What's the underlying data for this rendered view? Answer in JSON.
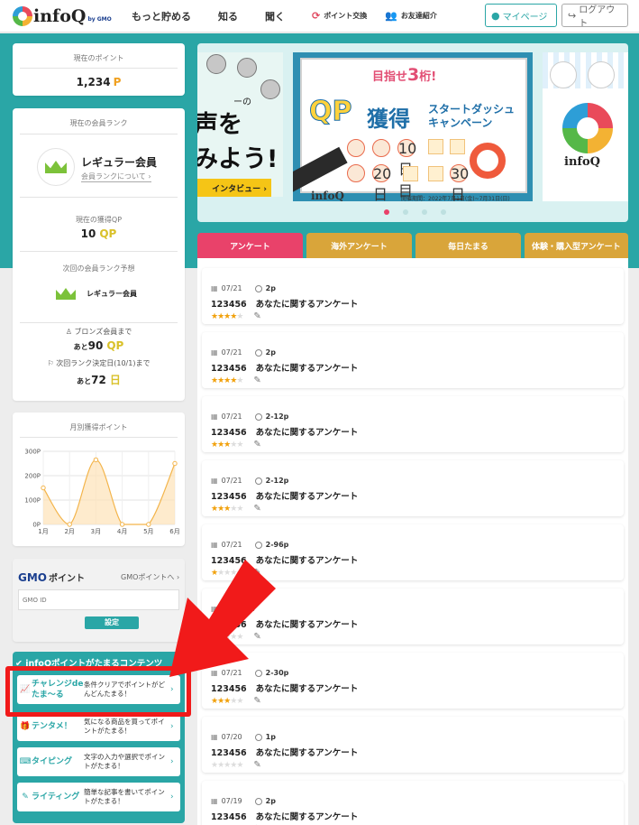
{
  "header": {
    "logo_text": "infoQ",
    "logo_sub": "by GMO",
    "nav": [
      "もっと貯める",
      "知る",
      "聞く"
    ],
    "nav_small": [
      "ポイント交換",
      "お友達紹介"
    ],
    "mypage_label": "マイページ",
    "logout_label": "ログアウト"
  },
  "points": {
    "title": "現在のポイント",
    "value": "1,234",
    "unit": "P"
  },
  "rank": {
    "title": "現在の会員ランク",
    "name": "レギュラー会員",
    "link": "会員ランクについて",
    "current_qp_title": "現在の獲得QP",
    "current_qp": "10",
    "qp_unit": "QP",
    "next_title": "次回の会員ランク予想",
    "next_rank": "レギュラー会員",
    "bronze_line": "ブロンズ会員まで",
    "bronze_prefix": "あと",
    "bronze_value": "90",
    "bronze_unit": "QP",
    "deadline_line": "次回ランク決定日(10/1)まで",
    "deadline_prefix": "あと",
    "deadline_value": "72",
    "deadline_unit": "日"
  },
  "chart_title": "月別獲得ポイント",
  "chart_data": {
    "type": "area",
    "title": "月別獲得ポイント",
    "categories": [
      "1月",
      "2月",
      "3月",
      "4月",
      "5月",
      "6月"
    ],
    "values": [
      150,
      0,
      265,
      0,
      0,
      250
    ],
    "y_ticks": [
      "0P",
      "100P",
      "200P",
      "300P"
    ],
    "ylim": [
      0,
      300
    ],
    "grid": true,
    "colors": {
      "line": "#f3b44a",
      "fill": "#fde3b8"
    }
  },
  "gmo": {
    "logo": "GMO",
    "logo_sub": "ポイント",
    "link": "GMOポイントへ",
    "input_placeholder": "GMO ID",
    "button": "設定"
  },
  "contents": {
    "title": "infoQポイントがたまるコンテンツ",
    "items": [
      {
        "icon": "chart-up-icon",
        "glyph": "📈",
        "name": "チャレンジdeたま～る",
        "desc": "条件クリアでポイントがどんどんたまる！"
      },
      {
        "icon": "gift-icon",
        "glyph": "🎁",
        "name": "テンタメ！",
        "desc": "気になる商品を買ってポイントがたまる！"
      },
      {
        "icon": "keyboard-icon",
        "glyph": "⌨",
        "name": "タイピング",
        "desc": "文字の入力や選択でポイントがたまる！"
      },
      {
        "icon": "pencil-icon",
        "glyph": "✎",
        "name": "ライティング",
        "desc": "簡単な記事を書いてポイントがたまる！"
      }
    ]
  },
  "banners": {
    "b1_small": "ーの",
    "b1_line1": "声を",
    "b1_line2": "みよう!",
    "b1_button": "インタビュー",
    "b2_aim": "目指せ",
    "b2_aim_num": "3",
    "b2_aim_suffix": "桁!",
    "b2_qp": "QP",
    "b2_kaku": "獲得",
    "b2_camp1": "スタートダッシュ",
    "b2_camp2": "キャンペーン",
    "b2_logo": "infoQ",
    "b2_period": "開催期間：2022年7月1日(金)~7月31日(日)",
    "stamp_labels": [
      "10日目",
      "20日目",
      "30日目"
    ],
    "b3_name": "infoQ"
  },
  "tabs": [
    "アンケート",
    "海外アンケート",
    "毎日たまる",
    "体験・購入型アンケート"
  ],
  "surveys": [
    {
      "date": "07/21",
      "points": "2p",
      "id": "123456",
      "title": "あなたに関するアンケート",
      "stars": 3.5
    },
    {
      "date": "07/21",
      "points": "2p",
      "id": "123456",
      "title": "あなたに関するアンケート",
      "stars": 3.5
    },
    {
      "date": "07/21",
      "points": "2-12p",
      "id": "123456",
      "title": "あなたに関するアンケート",
      "stars": 3
    },
    {
      "date": "07/21",
      "points": "2-12p",
      "id": "123456",
      "title": "あなたに関するアンケート",
      "stars": 3
    },
    {
      "date": "07/21",
      "points": "2-96p",
      "id": "123456",
      "title": "あなたに関するアンケート",
      "stars": 1
    },
    {
      "date": "",
      "points": "5p",
      "id": "123456",
      "title": "あなたに関するアンケート",
      "stars": 0
    },
    {
      "date": "07/21",
      "points": "2-30p",
      "id": "123456",
      "title": "あなたに関するアンケート",
      "stars": 3
    },
    {
      "date": "07/20",
      "points": "1p",
      "id": "123456",
      "title": "あなたに関するアンケート",
      "stars": 0
    },
    {
      "date": "07/19",
      "points": "2p",
      "id": "123456",
      "title": "あなたに関するアンケート",
      "stars": 0
    }
  ],
  "colors": {
    "teal": "#2aa6a6",
    "pink": "#e9426a",
    "gold": "#d9a53a",
    "annotation_red": "#f11a1a"
  }
}
